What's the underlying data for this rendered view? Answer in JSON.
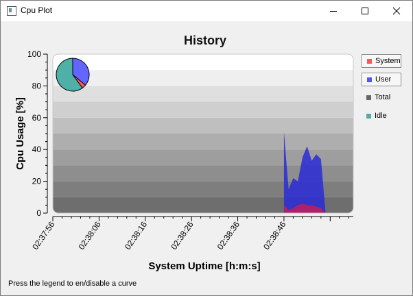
{
  "window": {
    "title": "Cpu Plot",
    "icon": "app-window-icon",
    "controls": [
      "minimize-icon",
      "maximize-icon",
      "close-icon"
    ]
  },
  "status": {
    "text": "Press the legend to en/disable a curve"
  },
  "legend": {
    "items": [
      {
        "label": "System",
        "color": "#ff5555",
        "pressed": true
      },
      {
        "label": "User",
        "color": "#5555ff",
        "pressed": true
      },
      {
        "label": "Total",
        "color": "#666666",
        "pressed": false
      },
      {
        "label": "Idle",
        "color": "#55aaaa",
        "pressed": false
      }
    ]
  },
  "colors": {
    "canvas_top": "#ffffff",
    "canvas_bottom": "#6e6e6e",
    "user_fill": "#2a2ad6",
    "system_fill": "#c0205a",
    "pie_user": "#6464ff",
    "pie_system": "#ff5a5a",
    "pie_idle": "#4fb0a8"
  },
  "chart_data": {
    "type": "area",
    "title": "History",
    "xlabel": "System Uptime [h:m:s]",
    "ylabel": "Cpu Usage [%]",
    "ylim": [
      0,
      100
    ],
    "yticks": [
      0,
      20,
      40,
      60,
      80,
      100
    ],
    "xlim": [
      0,
      65
    ],
    "xticks": [
      {
        "t": 0,
        "label": "02:37:56"
      },
      {
        "t": 10,
        "label": "02:38:06"
      },
      {
        "t": 20,
        "label": "02:38:16"
      },
      {
        "t": 30,
        "label": "02:38:26"
      },
      {
        "t": 40,
        "label": "02:38:36"
      },
      {
        "t": 50,
        "label": "02:38:46"
      }
    ],
    "series": [
      {
        "name": "User",
        "x": [
          50,
          51,
          52,
          53,
          54,
          55,
          56,
          57,
          58,
          59,
          60
        ],
        "values": [
          51,
          15,
          22,
          20,
          35,
          42,
          33,
          37,
          34,
          0,
          0
        ]
      },
      {
        "name": "System",
        "x": [
          50,
          51,
          52,
          53,
          54,
          55,
          56,
          57,
          58,
          59,
          60
        ],
        "values": [
          5,
          2,
          3,
          5,
          6,
          5,
          5,
          4,
          3,
          0,
          0
        ]
      }
    ],
    "pie": [
      {
        "name": "User",
        "value": 36
      },
      {
        "name": "System",
        "value": 4
      },
      {
        "name": "Idle",
        "value": 60
      }
    ],
    "grid": true,
    "legend_position": "right"
  }
}
